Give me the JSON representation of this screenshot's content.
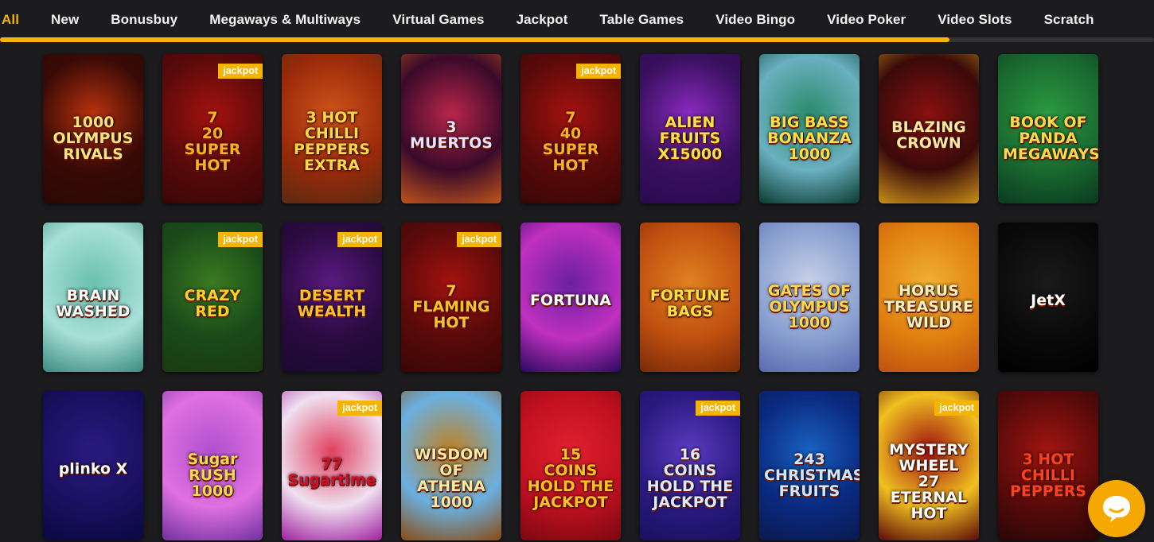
{
  "tabs": [
    "All",
    "New",
    "Bonusbuy",
    "Megaways & Multiways",
    "Virtual Games",
    "Jackpot",
    "Table Games",
    "Video Bingo",
    "Video Poker",
    "Video Slots",
    "Scratch"
  ],
  "scroll_progress": 0.823,
  "jackpot_label": "jackpot",
  "colors": {
    "accent": "#f5b400",
    "background": "#1c1c1e"
  },
  "games": [
    {
      "title": "1000\nOLYMPUS\nRIVALS",
      "jackpot": false,
      "bg": [
        "#3a0a06",
        "#b8320e",
        "#2a0804"
      ],
      "fg": "#ffe27a"
    },
    {
      "title": "7\n20\nSUPER HOT",
      "jackpot": true,
      "bg": [
        "#5a0a0a",
        "#a3120f",
        "#3a0606"
      ],
      "fg": "#ffb020"
    },
    {
      "title": "3 HOT CHILLI\nPEPPERS\nEXTRA",
      "jackpot": false,
      "bg": [
        "#9a2a0a",
        "#d0541a",
        "#5a2a12"
      ],
      "fg": "#ffd84a"
    },
    {
      "title": "3 MUERTOS",
      "jackpot": false,
      "bg": [
        "#3a0a2a",
        "#b8264a",
        "#c0541a"
      ],
      "fg": "#f0e0ff"
    },
    {
      "title": "7\n40\nSUPER\nHOT",
      "jackpot": true,
      "bg": [
        "#5a0a0a",
        "#a3120f",
        "#3a0606"
      ],
      "fg": "#ffb020"
    },
    {
      "title": "ALIEN\nFRUITS\nX15000",
      "jackpot": false,
      "bg": [
        "#3a1060",
        "#8a2ac0",
        "#2a0a50"
      ],
      "fg": "#ffe040"
    },
    {
      "title": "BIG BASS\nBONANZA\n1000",
      "jackpot": false,
      "bg": [
        "#6ab0c0",
        "#2a8a6a",
        "#0a3a30"
      ],
      "fg": "#ffe040"
    },
    {
      "title": "BLAZING\nCROWN",
      "jackpot": false,
      "bg": [
        "#3a0a0a",
        "#8a1010",
        "#c89018"
      ],
      "fg": "#ffe7a0"
    },
    {
      "title": "BOOK OF\nPANDA\nMEGAWAYS",
      "jackpot": false,
      "bg": [
        "#1a6a30",
        "#2a9a40",
        "#0a3a20"
      ],
      "fg": "#ffd84a"
    },
    {
      "title": "BRAIN\nWASHED",
      "jackpot": false,
      "bg": [
        "#a8e0d8",
        "#6ac0b0",
        "#3a8a80"
      ],
      "fg": "#ffffff"
    },
    {
      "title": "CRAZY\nRED",
      "jackpot": true,
      "bg": [
        "#1a4a1a",
        "#3a7a20",
        "#1a3a10"
      ],
      "fg": "#ffd020"
    },
    {
      "title": "DESERT\nWEALTH",
      "jackpot": true,
      "bg": [
        "#2a0a40",
        "#5a1a80",
        "#1a0a30"
      ],
      "fg": "#ffc020"
    },
    {
      "title": "7\nFLAMING\nHOT",
      "jackpot": true,
      "bg": [
        "#5a0a0a",
        "#a3120f",
        "#3a0606"
      ],
      "fg": "#ffc020"
    },
    {
      "title": "FORTUNA",
      "jackpot": false,
      "bg": [
        "#c030c0",
        "#6a20a0",
        "#2a0a60"
      ],
      "fg": "#ffffff"
    },
    {
      "title": "FORTUNE\nBAGS",
      "jackpot": false,
      "bg": [
        "#c05010",
        "#e08020",
        "#7a2a08"
      ],
      "fg": "#ffe040"
    },
    {
      "title": "GATES OF\nOLYMPUS\n1000",
      "jackpot": false,
      "bg": [
        "#8aa0d0",
        "#c8d0e8",
        "#5a6ab0"
      ],
      "fg": "#ffd84a"
    },
    {
      "title": "HORUS\nTREASURE\nWILD",
      "jackpot": false,
      "bg": [
        "#e08010",
        "#f0b030",
        "#c05010"
      ],
      "fg": "#fff0c0"
    },
    {
      "title": "JetX",
      "jackpot": false,
      "bg": [
        "#0a0a0a",
        "#1a1a1a",
        "#000000"
      ],
      "fg": "#ffffff"
    },
    {
      "title": "plinko X",
      "jackpot": false,
      "bg": [
        "#1a1060",
        "#2a1a80",
        "#0a0840"
      ],
      "fg": "#ffffff"
    },
    {
      "title": "Sugar\nRUSH\n1000",
      "jackpot": false,
      "bg": [
        "#e070e0",
        "#b050d0",
        "#7030a0"
      ],
      "fg": "#ffd84a"
    },
    {
      "title": "77\nSugartime",
      "jackpot": true,
      "bg": [
        "#f0e0f0",
        "#e04060",
        "#a020a0"
      ],
      "fg": "#d01030"
    },
    {
      "title": "WISDOM\nOF\nATHENA\n1000",
      "jackpot": false,
      "bg": [
        "#6ab0e0",
        "#c08020",
        "#8a4a10"
      ],
      "fg": "#ffe7a0"
    },
    {
      "title": "15\nCOINS\nHOLD THE JACKPOT",
      "jackpot": false,
      "bg": [
        "#c01020",
        "#e02030",
        "#7a0810"
      ],
      "fg": "#ffc020"
    },
    {
      "title": "16\nCOINS\nHOLD THE JACKPOT",
      "jackpot": true,
      "bg": [
        "#2a1a80",
        "#5a3ac0",
        "#1a1060"
      ],
      "fg": "#e0e8ff"
    },
    {
      "title": "243\nCHRISTMAS\nFRUITS",
      "jackpot": false,
      "bg": [
        "#0a2a80",
        "#1a60c0",
        "#0a1a50"
      ],
      "fg": "#cfe6ff"
    },
    {
      "title": "MYSTERY\nWHEEL\n27\nETERNAL\nHOT",
      "jackpot": true,
      "bg": [
        "#f0c020",
        "#a01010",
        "#5a0808"
      ],
      "fg": "#ffffff"
    },
    {
      "title": "3 HOT\nCHILLI\nPEPPERS",
      "jackpot": false,
      "bg": [
        "#5a0a0a",
        "#a01510",
        "#2a0606"
      ],
      "fg": "#ff4020"
    }
  ]
}
